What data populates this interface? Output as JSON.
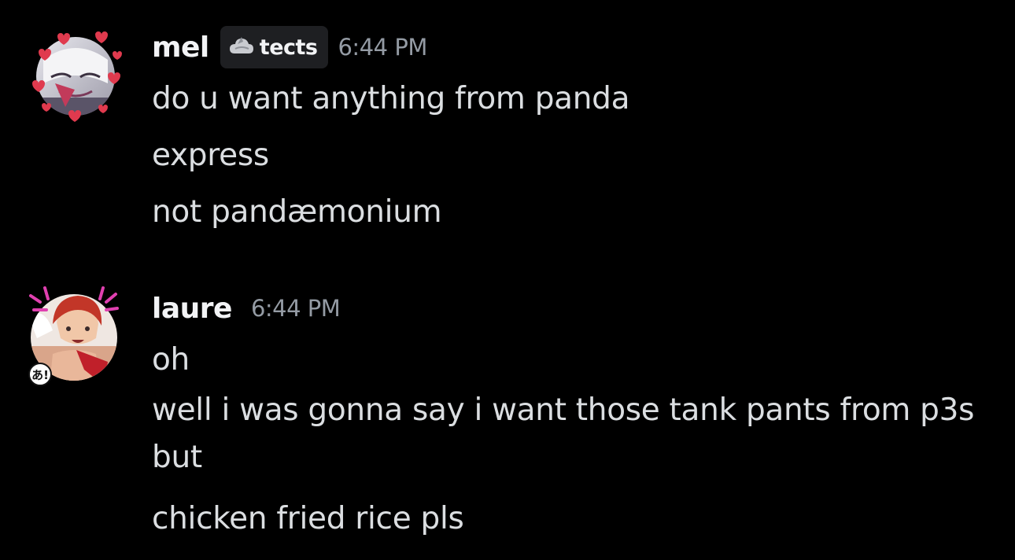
{
  "messages": [
    {
      "author": "mel",
      "tag": "tects",
      "tag_icon": "cloud-icon",
      "timestamp": "6:44 PM",
      "avatar": "hearts-avatar",
      "lines": [
        "do u want anything from panda",
        "express",
        "not pandæmonium"
      ]
    },
    {
      "author": "laure",
      "timestamp": "6:44 PM",
      "avatar": "anime-red-hair-avatar",
      "badge": "あ!",
      "lines": [
        "oh",
        "well i was gonna say i want those tank pants from p3s but",
        "chicken fried rice pls"
      ]
    }
  ],
  "colors": {
    "background": "#000000",
    "username": "#f2f3f5",
    "text": "#dbdee1",
    "timestamp": "#949ba4",
    "tag_bg": "#1e1f22"
  }
}
